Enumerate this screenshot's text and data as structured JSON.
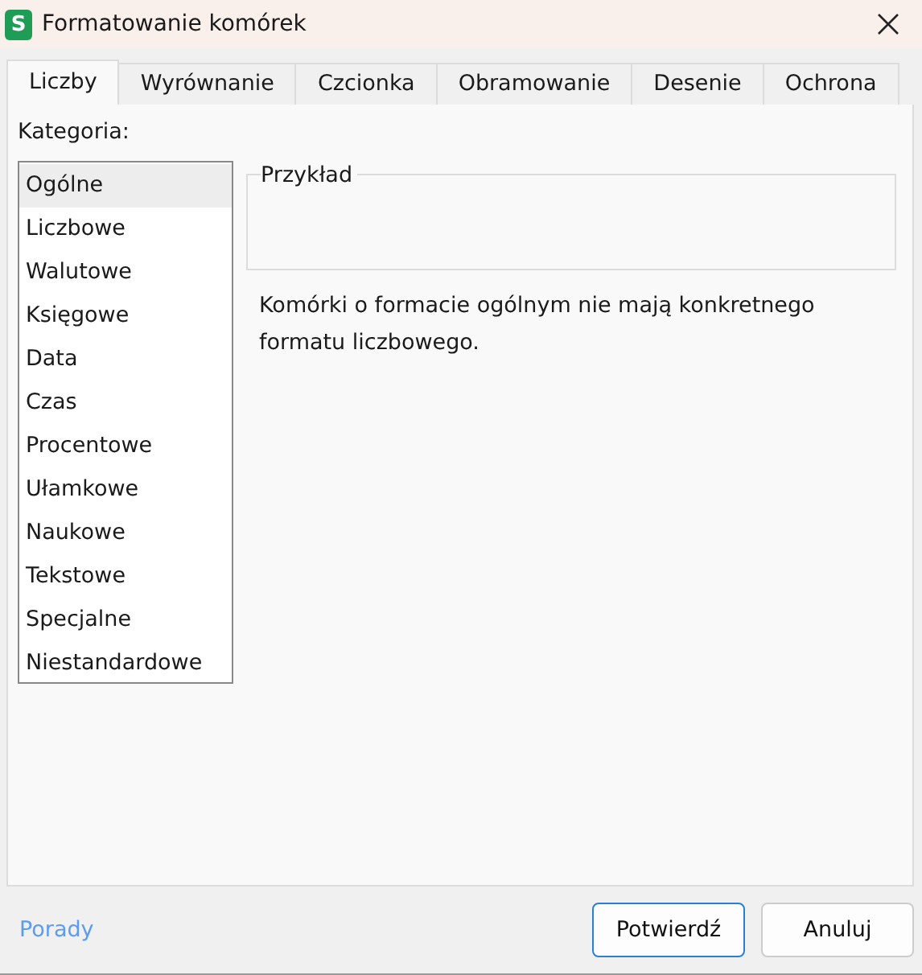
{
  "window": {
    "title": "Formatowanie komórek",
    "app_icon": "S"
  },
  "tabs": [
    {
      "label": "Liczby",
      "selected": true
    },
    {
      "label": "Wyrównanie",
      "selected": false
    },
    {
      "label": "Czcionka",
      "selected": false
    },
    {
      "label": "Obramowanie",
      "selected": false
    },
    {
      "label": "Desenie",
      "selected": false
    },
    {
      "label": "Ochrona",
      "selected": false
    }
  ],
  "category": {
    "label": "Kategoria:",
    "items": [
      {
        "label": "Ogólne",
        "selected": true
      },
      {
        "label": "Liczbowe",
        "selected": false
      },
      {
        "label": "Walutowe",
        "selected": false
      },
      {
        "label": "Księgowe",
        "selected": false
      },
      {
        "label": "Data",
        "selected": false
      },
      {
        "label": "Czas",
        "selected": false
      },
      {
        "label": "Procentowe",
        "selected": false
      },
      {
        "label": "Ułamkowe",
        "selected": false
      },
      {
        "label": "Naukowe",
        "selected": false
      },
      {
        "label": "Tekstowe",
        "selected": false
      },
      {
        "label": "Specjalne",
        "selected": false
      },
      {
        "label": "Niestandardowe",
        "selected": false
      }
    ]
  },
  "sample": {
    "legend": "Przykład"
  },
  "description": "Komórki o formacie ogólnym nie mają konkretnego formatu liczbowego.",
  "footer": {
    "link": "Porady",
    "buttons": [
      {
        "label": "Potwierdź",
        "kind": "primary"
      },
      {
        "label": "Anuluj",
        "kind": "secondary"
      }
    ]
  }
}
